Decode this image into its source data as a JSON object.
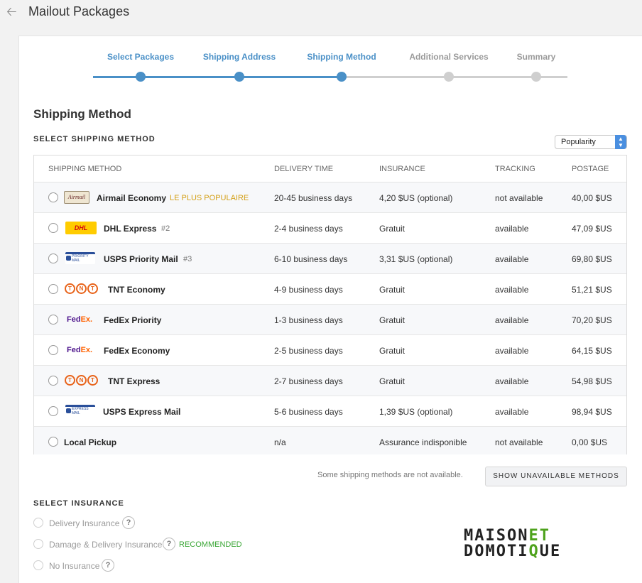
{
  "header": {
    "title": "Mailout Packages",
    "back_icon": "arrow-left-icon"
  },
  "stepper": {
    "steps": [
      {
        "label": "Select Packages",
        "state": "done"
      },
      {
        "label": "Shipping Address",
        "state": "done"
      },
      {
        "label": "Shipping Method",
        "state": "done"
      },
      {
        "label": "Additional Services",
        "state": "todo"
      },
      {
        "label": "Summary",
        "state": "todo"
      }
    ],
    "active_color": "#4a90c7",
    "inactive_color": "#cfcfcf"
  },
  "section_title": "Shipping Method",
  "select_method_heading": "SELECT SHIPPING METHOD",
  "sort": {
    "selected": "Popularity"
  },
  "table": {
    "headers": [
      "SHIPPING METHOD",
      "DELIVERY TIME",
      "INSURANCE",
      "TRACKING",
      "POSTAGE"
    ],
    "rows": [
      {
        "logo": "airmail",
        "logo_text": "Airmail",
        "name": "Airmail Economy",
        "tag": "LE PLUS POPULAIRE",
        "delivery": "20-45 business days",
        "insurance": "4,20 $US (optional)",
        "tracking": "not available",
        "postage": "40,00 $US"
      },
      {
        "logo": "dhl",
        "logo_text": "DHL",
        "name": "DHL Express",
        "tag": "#2",
        "delivery": "2-4 business days",
        "insurance": "Gratuit",
        "tracking": "available",
        "postage": "47,09 $US"
      },
      {
        "logo": "usps",
        "logo_text": "PRIORITY MAIL",
        "name": "USPS Priority Mail",
        "tag": "#3",
        "delivery": "6-10 business days",
        "insurance": "3,31 $US (optional)",
        "tracking": "available",
        "postage": "69,80 $US"
      },
      {
        "logo": "tnt",
        "logo_text": "T N T",
        "name": "TNT Economy",
        "tag": "",
        "delivery": "4-9 business days",
        "insurance": "Gratuit",
        "tracking": "available",
        "postage": "51,21 $US"
      },
      {
        "logo": "fedex",
        "logo_text_fe": "Fed",
        "logo_text_ex": "Ex.",
        "name": "FedEx Priority",
        "tag": "",
        "delivery": "1-3 business days",
        "insurance": "Gratuit",
        "tracking": "available",
        "postage": "70,20 $US"
      },
      {
        "logo": "fedex",
        "logo_text_fe": "Fed",
        "logo_text_ex": "Ex.",
        "name": "FedEx Economy",
        "tag": "",
        "delivery": "2-5 business days",
        "insurance": "Gratuit",
        "tracking": "available",
        "postage": "64,15 $US"
      },
      {
        "logo": "tnt",
        "logo_text": "T N T",
        "name": "TNT Express",
        "tag": "",
        "delivery": "2-7 business days",
        "insurance": "Gratuit",
        "tracking": "available",
        "postage": "54,98 $US"
      },
      {
        "logo": "usps",
        "logo_text": "EXPRESS MAIL",
        "name": "USPS Express Mail",
        "tag": "",
        "delivery": "5-6 business days",
        "insurance": "1,39 $US (optional)",
        "tracking": "available",
        "postage": "98,94 $US"
      },
      {
        "logo": "none",
        "name": "Local Pickup",
        "tag": "",
        "delivery": "n/a",
        "insurance": "Assurance indisponible",
        "tracking": "not available",
        "postage": "0,00 $US"
      }
    ]
  },
  "unavailable_note": "Some shipping methods are not available.",
  "show_unavailable_label": "SHOW UNAVAILABLE METHODS",
  "insurance": {
    "heading": "SELECT INSURANCE",
    "options": [
      {
        "label": "Delivery Insurance",
        "help": "?"
      },
      {
        "label": "Damage & Delivery Insurance",
        "help": "?",
        "badge": "RECOMMENDED"
      },
      {
        "label": "No Insurance",
        "help": "?"
      }
    ]
  },
  "watermark": {
    "line1": "MAISON",
    "line1_accent": "ET",
    "line2": "DOMOTI",
    "line2_accent": "Q",
    "line2_end": "UE"
  }
}
